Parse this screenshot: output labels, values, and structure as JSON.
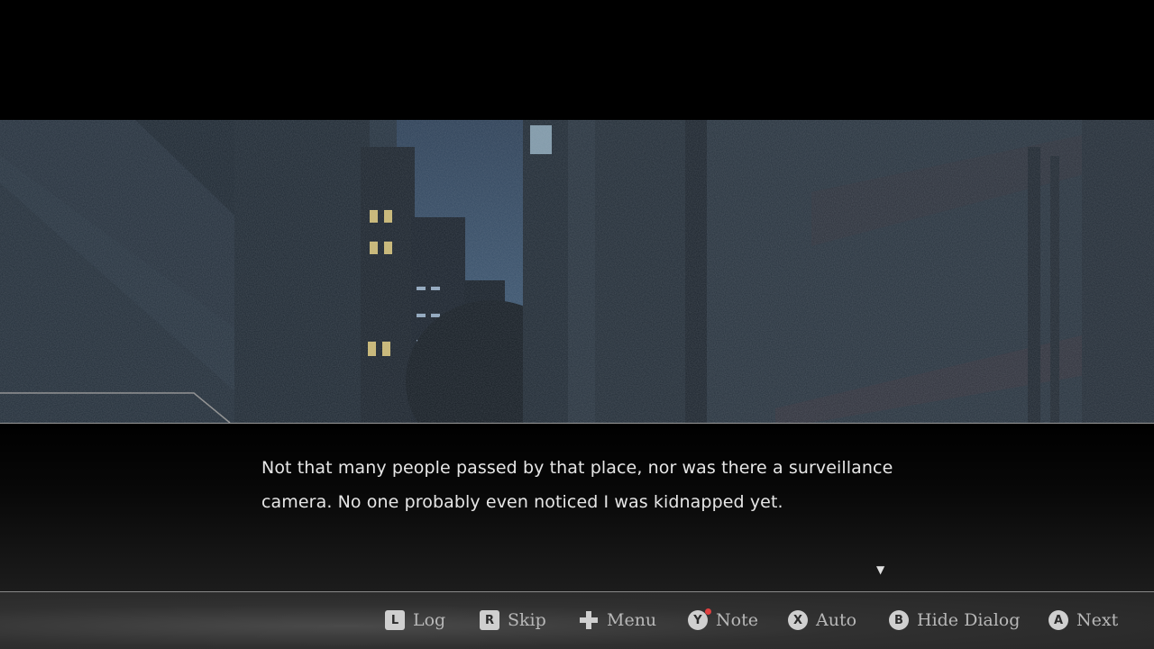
{
  "dialog": {
    "line1": "Not that many people passed by that place, nor was there a surveillance",
    "line2": "camera. No one probably even noticed I was kidnapped yet.",
    "advance_glyph": "▼"
  },
  "controls": [
    {
      "key": "L",
      "label": "Log"
    },
    {
      "key": "R",
      "label": "Skip"
    },
    {
      "key": "+",
      "label": "Menu"
    },
    {
      "key": "Y",
      "label": "Note"
    },
    {
      "key": "X",
      "label": "Auto"
    },
    {
      "key": "B",
      "label": "Hide Dialog"
    },
    {
      "key": "A",
      "label": "Next"
    }
  ],
  "colors": {
    "dialog_text": "#e6e6e6",
    "control_text": "#b8b8b8",
    "key_glyph": "#cfcfcf",
    "note_alert": "#e04040"
  }
}
